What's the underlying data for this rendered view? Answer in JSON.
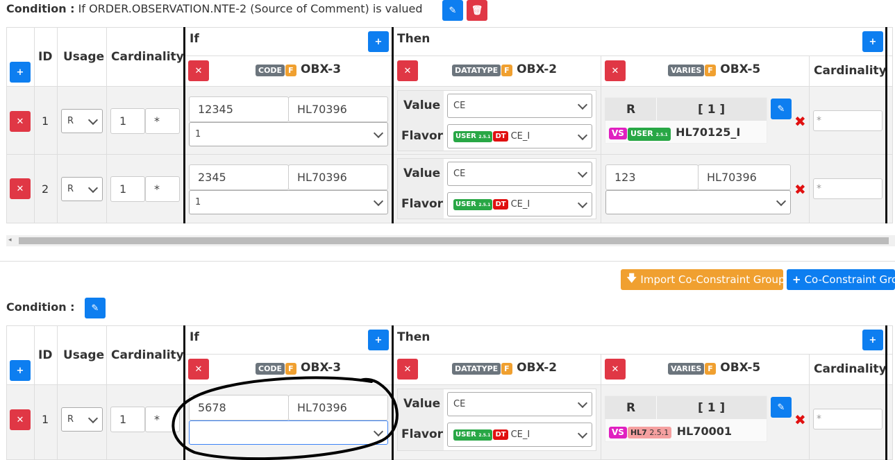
{
  "group1": {
    "condition_label": "Condition :",
    "condition_text": "If ORDER.OBSERVATION.NTE-2 (Source of Comment) is valued",
    "headers": {
      "id": "ID",
      "usage": "Usage",
      "cardinality": "Cardinality",
      "if": "If",
      "then": "Then",
      "cardinality_right": "Cardinality"
    },
    "if_col": {
      "badge": "CODE",
      "flag": "F",
      "field": "OBX-3"
    },
    "then_col1": {
      "badge": "DATATYPE",
      "flag": "F",
      "field": "OBX-2"
    },
    "then_col2": {
      "badge": "VARIES",
      "flag": "F",
      "field": "OBX-5"
    },
    "rows": [
      {
        "id": "1",
        "usage": "R",
        "min": "1",
        "max": "*",
        "code": "12345",
        "code_system": "HL70396",
        "if_select": "1",
        "value_label": "Value",
        "value": "CE",
        "flavor_label": "Flavor",
        "flavor_user": "USER",
        "flavor_ver": "2.5.1",
        "flavor_dt": "DT",
        "flavor": "CE_I",
        "vs_r": "R",
        "vs_card": "[ 1 ]",
        "vs_badge": "VS",
        "vs_user": "USER",
        "vs_ver": "2.5.1",
        "vs_name": "HL70125_I",
        "card_placeholder": "*"
      },
      {
        "id": "2",
        "usage": "R",
        "min": "1",
        "max": "*",
        "code": "2345",
        "code_system": "HL70396",
        "if_select": "1",
        "value_label": "Value",
        "value": "CE",
        "flavor_label": "Flavor",
        "flavor_user": "USER",
        "flavor_ver": "2.5.1",
        "flavor_dt": "DT",
        "flavor": "CE_I",
        "obx5_code": "123",
        "obx5_system": "HL70396",
        "obx5_select": "",
        "card_placeholder": "*"
      }
    ]
  },
  "actions": {
    "import_label": "Import Co-Constraint Group",
    "add_group_label": "Co-Constraint Grou"
  },
  "group2": {
    "condition_label": "Condition :",
    "headers": {
      "id": "ID",
      "usage": "Usage",
      "cardinality": "Cardinality",
      "if": "If",
      "then": "Then",
      "cardinality_right": "Cardinality"
    },
    "if_col": {
      "badge": "CODE",
      "flag": "F",
      "field": "OBX-3"
    },
    "then_col1": {
      "badge": "DATATYPE",
      "flag": "F",
      "field": "OBX-2"
    },
    "then_col2": {
      "badge": "VARIES",
      "flag": "F",
      "field": "OBX-5"
    },
    "row": {
      "id": "1",
      "usage": "R",
      "min": "1",
      "max": "*",
      "code": "5678",
      "code_system": "HL70396",
      "if_select": "",
      "value_label": "Value",
      "value": "CE",
      "flavor_label": "Flavor",
      "flavor_user": "USER",
      "flavor_ver": "2.5.1",
      "flavor_dt": "DT",
      "flavor": "CE_I",
      "vs_r": "R",
      "vs_card": "[ 1 ]",
      "vs_badge": "VS",
      "vs_lib": "HL7",
      "vs_ver": "2.5.1",
      "vs_name": "HL70001",
      "card_placeholder": "*"
    }
  },
  "colors": {
    "primary": "#0d7ef0",
    "danger": "#e03745",
    "warning": "#f0a030"
  }
}
